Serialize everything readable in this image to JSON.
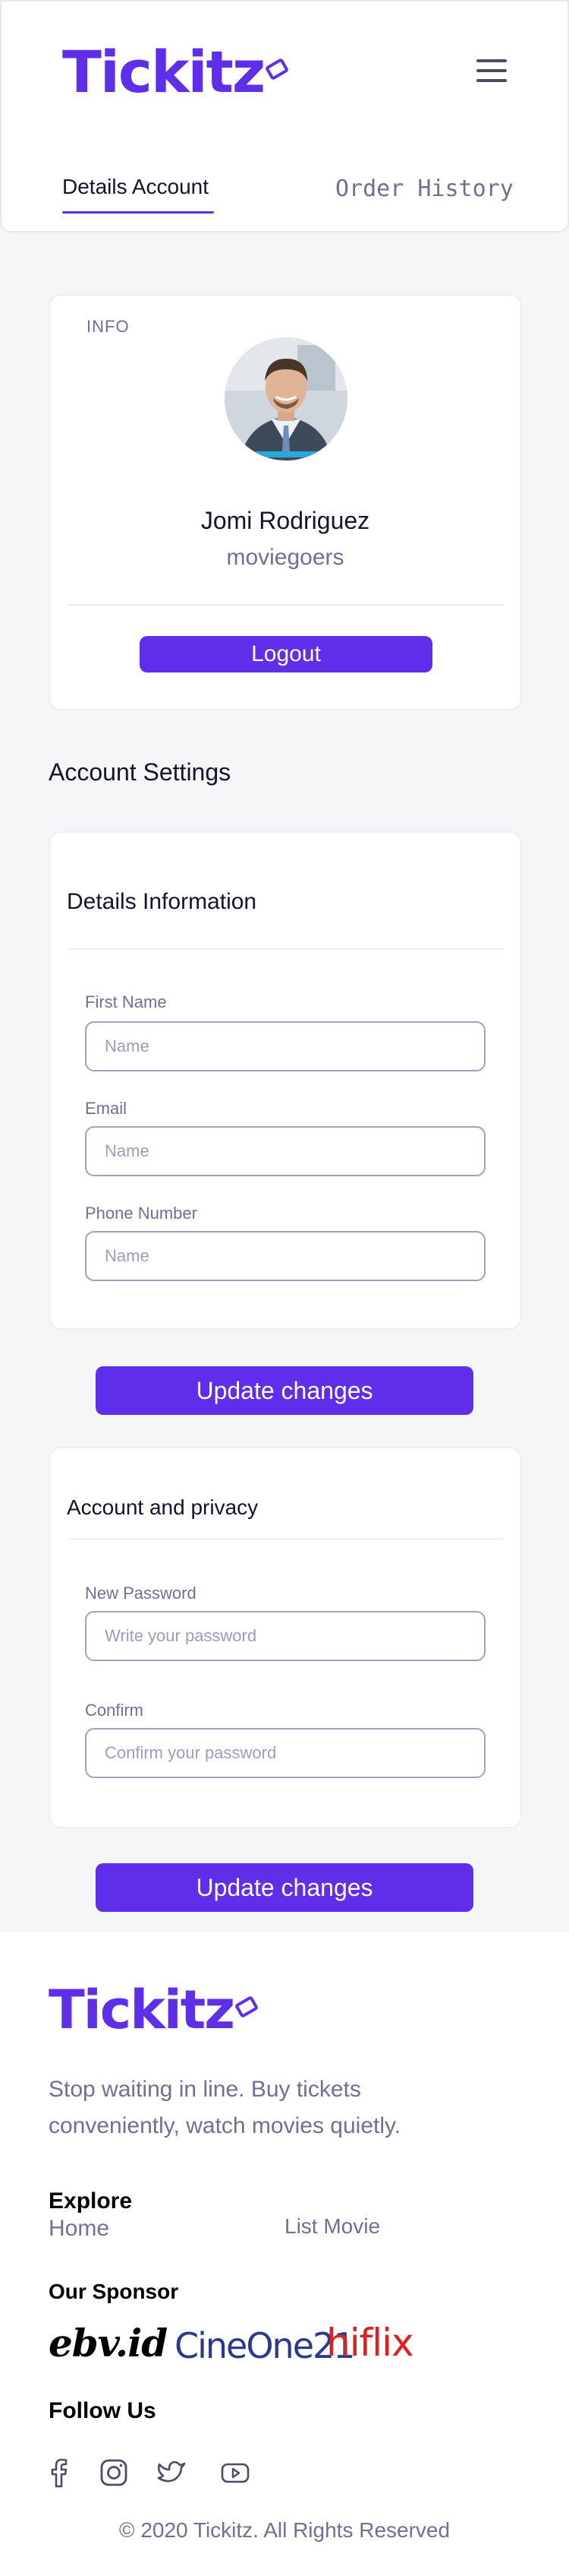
{
  "header": {
    "logo": "Tickitz",
    "tabs": [
      {
        "label": "Details Account",
        "active": true
      },
      {
        "label": "Order History",
        "active": false
      }
    ],
    "menu_icon": "hamburger-icon"
  },
  "profile": {
    "info_label": "INFO",
    "name": "Jomi Rodriguez",
    "role": "moviegoers",
    "logout_label": "Logout"
  },
  "settings": {
    "title": "Account Settings",
    "details": {
      "heading": "Details Information",
      "fields": [
        {
          "label": "First Name",
          "placeholder": "Name",
          "value": ""
        },
        {
          "label": "Email",
          "placeholder": "Name",
          "value": ""
        },
        {
          "label": "Phone Number",
          "placeholder": "Name",
          "value": ""
        }
      ],
      "update_label": "Update changes"
    },
    "privacy": {
      "heading": "Account and privacy",
      "fields": [
        {
          "label": "New Password",
          "placeholder": "Write your password",
          "value": ""
        },
        {
          "label": "Confirm",
          "placeholder": "Confirm your password",
          "value": ""
        }
      ],
      "update_label": "Update changes"
    }
  },
  "footer": {
    "logo": "Tickitz",
    "tagline": "Stop waiting in line. Buy tickets conveniently, watch movies quietly.",
    "explore_heading": "Explore",
    "explore_links": [
      "Home",
      "List Movie"
    ],
    "sponsor_heading": "Our Sponsor",
    "sponsors": [
      "ebv.id",
      "CineOne21",
      "hiflix"
    ],
    "follow_heading": "Follow Us",
    "social_icons": [
      "facebook-icon",
      "instagram-icon",
      "twitter-icon",
      "youtube-icon"
    ],
    "copyright": "© 2020 Tickitz. All Rights Reserved"
  },
  "colors": {
    "accent": "#5f2eea",
    "text_dark": "#14142b",
    "text_muted": "#6e7191",
    "input_border": "#a0a3bd",
    "background": "#f5f6f8"
  }
}
